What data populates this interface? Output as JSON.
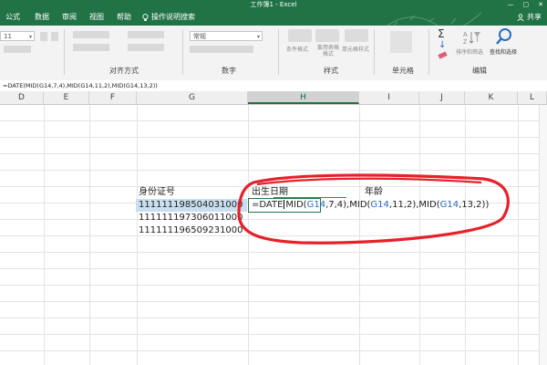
{
  "window": {
    "title": "工作簿1 - Excel",
    "win_buttons": [
      "—",
      "▢",
      "✕"
    ]
  },
  "ribbon_tabs": [
    "公式",
    "数据",
    "审阅",
    "视图",
    "帮助"
  ],
  "tell_me": "操作说明搜索",
  "share": "共享",
  "ribbon": {
    "font_size": "11",
    "number_format": "常规",
    "groups": {
      "alignment": "对齐方式",
      "number": "数字",
      "styles": "样式",
      "cells": "单元格",
      "editing": "编辑"
    },
    "style_buttons": [
      "条件格式",
      "套用表格格式",
      "单元格样式"
    ],
    "editing_buttons": [
      "排序和筛选",
      "查找和选择"
    ],
    "symbols": [
      "Σ",
      "↓"
    ]
  },
  "formula_bar": {
    "text": "=DATE(MID(G14,7,4),MID(G14,11,2),MID(G14,13,2))"
  },
  "columns": [
    "D",
    "E",
    "F",
    "G",
    "H",
    "I",
    "J",
    "K",
    "L"
  ],
  "active_column": "H",
  "cells": {
    "header_id": "身份证号",
    "header_birth": "出生日期",
    "header_age": "年龄",
    "id1": "111111198504031000",
    "id2": "111111197306011000",
    "id3": "111111196509231000"
  },
  "formula_tokens": [
    {
      "t": "=DATE",
      "ref": false
    },
    {
      "t": "MID(",
      "ref": false
    },
    {
      "t": "G14",
      "ref": true
    },
    {
      "t": ",7,4),MID(",
      "ref": false
    },
    {
      "t": "G14",
      "ref": true
    },
    {
      "t": ",11,2),MID(",
      "ref": false
    },
    {
      "t": "G14",
      "ref": true
    },
    {
      "t": ",13,2))",
      "ref": false
    }
  ],
  "colors": {
    "excel_green": "#217346",
    "annotation_red": "#e8202a",
    "ref_blue": "#2b6cc4",
    "selection_blue": "#c9dff0"
  }
}
